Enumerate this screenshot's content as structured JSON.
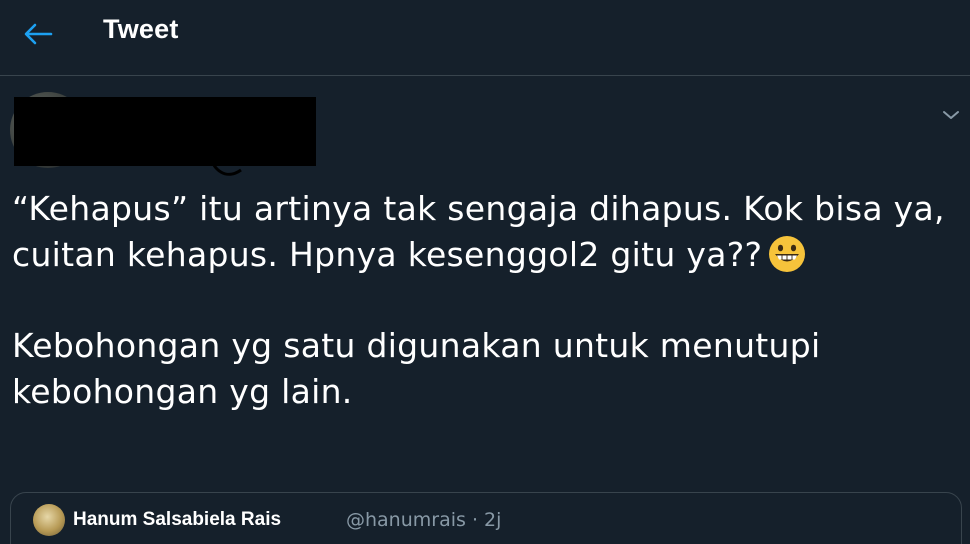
{
  "header": {
    "title": "Tweet",
    "back_icon": "arrow-left-icon"
  },
  "tweet": {
    "paragraph1": "“Kehapus” itu artinya tak sengaja dihapus. Kok bisa ya, cuitan kehapus. Hpnya kesenggol2 gitu ya??",
    "emoji": "grinning-face-icon",
    "paragraph2": "Kebohongan yg satu digunakan untuk menutupi kebohongan yg lain."
  },
  "quoted_tweet": {
    "name": "Hanum Salsabiela Rais",
    "handle": "@hanumrais · 2j"
  },
  "colors": {
    "background": "#15202b",
    "accent": "#1da1f2",
    "secondary_text": "#8899a6",
    "border": "#38444d"
  }
}
